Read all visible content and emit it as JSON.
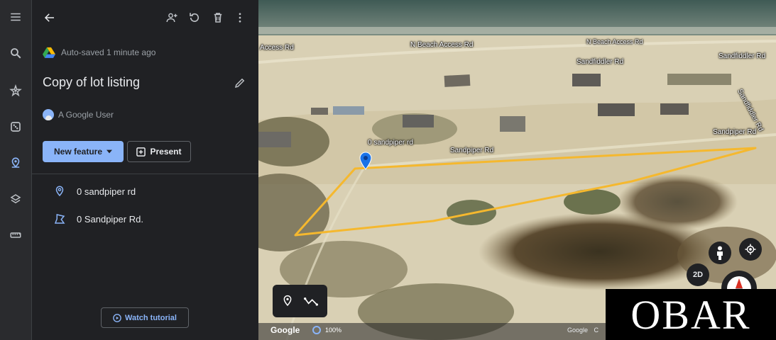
{
  "rail": {
    "icons": [
      "menu-icon",
      "search-icon",
      "voyager-icon",
      "feeling-lucky-icon",
      "projects-icon",
      "layers-icon",
      "measure-icon"
    ]
  },
  "header": {
    "icons": [
      "back-arrow-icon",
      "add-person-icon",
      "history-icon",
      "delete-icon",
      "more-vert-icon"
    ]
  },
  "project": {
    "autosave_text": "Auto-saved 1 minute ago",
    "title": "Copy of lot listing",
    "owner": "A Google User"
  },
  "actions": {
    "new_feature_label": "New feature",
    "present_label": "Present"
  },
  "features": [
    {
      "label": "0 sandpiper rd",
      "icon": "placemark-icon"
    },
    {
      "label": "0 Sandpiper Rd.",
      "icon": "polygon-icon"
    }
  ],
  "tutorial": {
    "label": "Watch tutorial"
  },
  "map": {
    "road_labels": {
      "access_left": "Access Rd",
      "n_beach_access": "N Beach Access Rd",
      "n_beach_access_2": "N Beach Access Rd",
      "sandfiddler_1": "Sandfiddler Rd",
      "sandfiddler_2": "Sandfiddler Rd",
      "sandpiper_pin": "0 sandpiper rd",
      "sandpiper_mid": "Sandpiper Rd",
      "sandpiper_right": "Sandpiper Rd",
      "right_edge": "Sandfiddler Rd"
    },
    "view_mode_label": "2D",
    "google_label": "Google",
    "zoom_label": "100%",
    "attribution": "Google",
    "attribution_suffix": "C",
    "watermark": "OBAR"
  },
  "colors": {
    "panel_bg": "#202124",
    "rail_bg": "#2a2b2e",
    "accent": "#8ab4f8",
    "polygon": "#f5b82e",
    "pin": "#1a73e8",
    "sand": "#d9d0b4"
  }
}
